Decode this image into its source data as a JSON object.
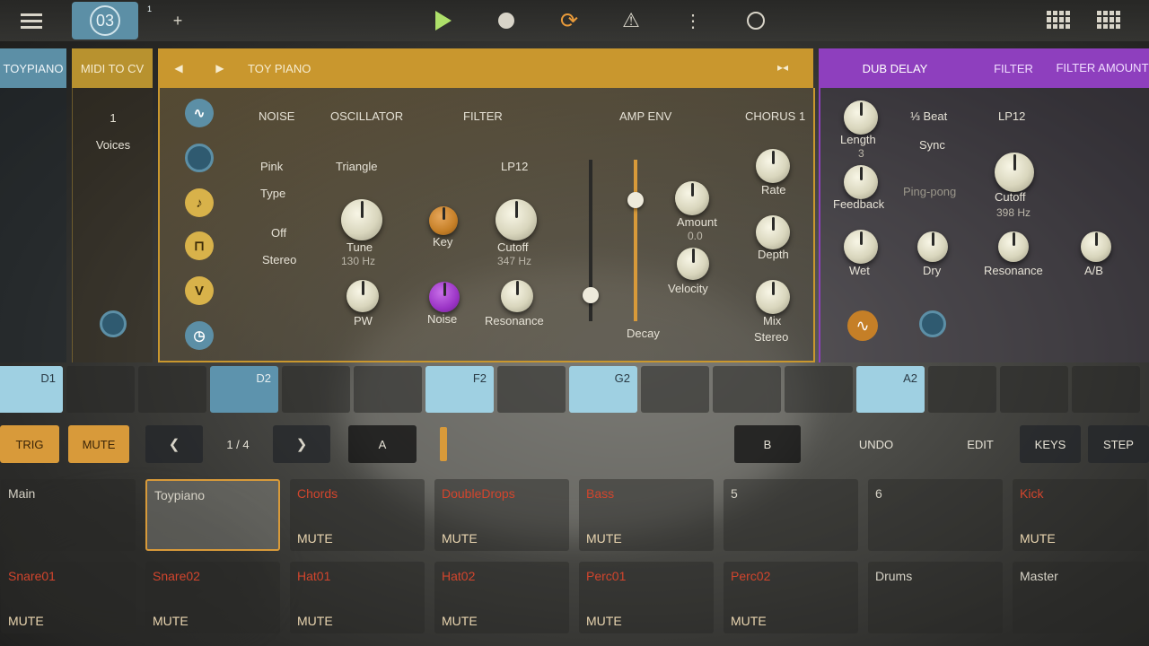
{
  "topbar": {
    "pattern_number": "03",
    "pattern_small": "1",
    "add_label": "+",
    "loop_glyph": "⟳",
    "metronome_glyph": "⚠",
    "more_glyph": "⋮"
  },
  "tabs": {
    "track": "TOYPIANO",
    "midi": "MIDI TO CV",
    "prev_glyph": "◀",
    "next_glyph": "▶",
    "instrument": "TOY PIANO",
    "collapse_glyph": "▸◂",
    "fx1": "DUB DELAY",
    "fx2": "FILTER",
    "fx3": "FILTER AMOUNT"
  },
  "midi_panel": {
    "voices_value": "1",
    "voices_label": "Voices"
  },
  "instrument": {
    "sections": [
      "NOISE",
      "OSCILLATOR",
      "FILTER",
      "AMP ENV",
      "CHORUS 1"
    ],
    "noise_type_value": "Pink",
    "noise_type_label": "Type",
    "osc_wave": "Triangle",
    "stereo_value": "Off",
    "stereo_label": "Stereo",
    "filter_mode": "LP12",
    "knobs": {
      "tune": "Tune",
      "tune_val": "130 Hz",
      "key": "Key",
      "cutoff": "Cutoff",
      "cutoff_val": "347 Hz",
      "pw": "PW",
      "noise": "Noise",
      "resonance": "Resonance",
      "amount": "Amount",
      "amount_val": "0.0",
      "velocity": "Velocity",
      "rate": "Rate",
      "depth": "Depth",
      "mix": "Mix",
      "mix_label2": "Stereo",
      "decay": "Decay"
    }
  },
  "fx": {
    "length": "Length",
    "length_val": "3",
    "feedback": "Feedback",
    "wet": "Wet",
    "sync_value": "⅓ Beat",
    "sync_label": "Sync",
    "pingpong": "Ping-pong",
    "dry": "Dry",
    "filter_mode": "LP12",
    "cutoff": "Cutoff",
    "cutoff_val": "398 Hz",
    "resonance": "Resonance",
    "ab": "A/B"
  },
  "strip": {
    "cells": [
      {
        "label": "D1",
        "on": true,
        "light": true
      },
      {
        "label": "",
        "on": false
      },
      {
        "label": "",
        "on": false
      },
      {
        "label": "D2",
        "on": true
      },
      {
        "label": "",
        "on": false
      },
      {
        "label": "",
        "on": false
      },
      {
        "label": "F2",
        "on": true,
        "light": true
      },
      {
        "label": "",
        "on": false
      },
      {
        "label": "G2",
        "on": true,
        "light": true
      },
      {
        "label": "",
        "on": false
      },
      {
        "label": "",
        "on": false
      },
      {
        "label": "",
        "on": false
      },
      {
        "label": "A2",
        "on": true,
        "light": true
      },
      {
        "label": "",
        "on": false
      },
      {
        "label": "",
        "on": false
      },
      {
        "label": "",
        "on": false
      }
    ]
  },
  "controls": {
    "trig": "TRIG",
    "mute": "MUTE",
    "prev": "❮",
    "page": "1 / 4",
    "next": "❯",
    "a": "A",
    "b": "B",
    "undo": "UNDO",
    "edit": "EDIT",
    "keys": "KEYS",
    "step": "STEP"
  },
  "tracks_row1": [
    {
      "name": "Main",
      "mute": "",
      "red": false,
      "sel": false
    },
    {
      "name": "Toypiano",
      "mute": "",
      "red": false,
      "sel": true
    },
    {
      "name": "Chords",
      "mute": "MUTE",
      "red": true,
      "sel": false
    },
    {
      "name": "DoubleDrops",
      "mute": "MUTE",
      "red": true,
      "sel": false
    },
    {
      "name": "Bass",
      "mute": "MUTE",
      "red": true,
      "sel": false
    },
    {
      "name": "5",
      "mute": "",
      "red": false,
      "sel": false
    },
    {
      "name": "6",
      "mute": "",
      "red": false,
      "sel": false
    },
    {
      "name": "Kick",
      "mute": "MUTE",
      "red": true,
      "sel": false
    }
  ],
  "tracks_row2": [
    {
      "name": "Snare01",
      "mute": "MUTE",
      "red": true
    },
    {
      "name": "Snare02",
      "mute": "MUTE",
      "red": true
    },
    {
      "name": "Hat01",
      "mute": "MUTE",
      "red": true
    },
    {
      "name": "Hat02",
      "mute": "MUTE",
      "red": true
    },
    {
      "name": "Perc01",
      "mute": "MUTE",
      "red": true
    },
    {
      "name": "Perc02",
      "mute": "MUTE",
      "red": true
    },
    {
      "name": "Drums",
      "mute": "",
      "red": false
    },
    {
      "name": "Master",
      "mute": "",
      "red": false
    }
  ]
}
